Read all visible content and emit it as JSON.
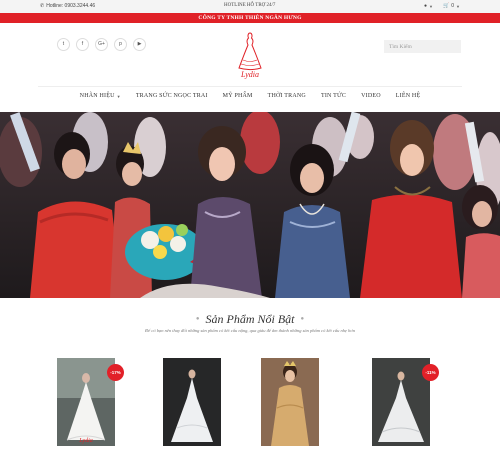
{
  "topbar": {
    "hotline_left": "Hotline: 0903.3244.46",
    "hotline_center": "HOTLINE HỖ TRỢ 24/7",
    "cart_count": "0"
  },
  "company_name": "CÔNG TY TNHH THIÊN NGÂN HƯNG",
  "social": [
    {
      "icon": "twitter-icon",
      "glyph": "t"
    },
    {
      "icon": "facebook-icon",
      "glyph": "f"
    },
    {
      "icon": "google-plus-icon",
      "glyph": "G+"
    },
    {
      "icon": "pinterest-icon",
      "glyph": "p"
    },
    {
      "icon": "youtube-icon",
      "glyph": "▶"
    }
  ],
  "logo_text": "Lydia",
  "search": {
    "placeholder": "Tìm Kiếm"
  },
  "nav": [
    "NHÃN HIỆU",
    "TRANG SỨC NGỌC TRAI",
    "MỸ PHẨM",
    "THỜI TRANG",
    "TIN TỨC",
    "VIDEO",
    "LIÊN HỆ"
  ],
  "featured": {
    "title": "Sản Phẩm Nổi Bật",
    "subtitle": "Để có bạn nên thay đổi những sản phẩm có kết cấu nặng, qua giàu để âm thành những sản phẩm có kết cấu nhẹ hơn"
  },
  "products": [
    {
      "badge": "-17%"
    },
    {
      "badge": ""
    },
    {
      "badge": ""
    },
    {
      "badge": "-11%"
    }
  ],
  "colors": {
    "brand_red": "#e02127",
    "topbar_bg": "#f4f4f4"
  }
}
